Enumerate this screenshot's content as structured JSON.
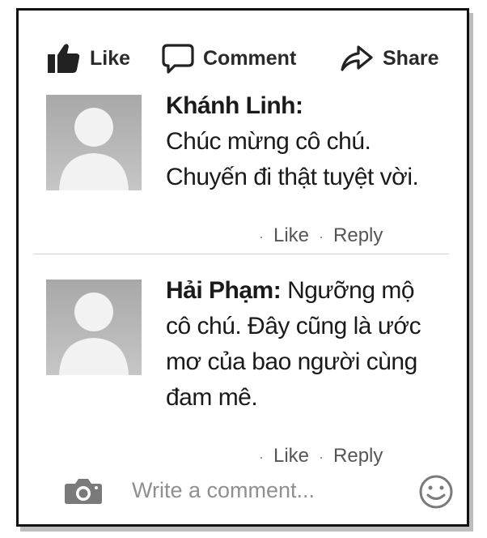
{
  "actions": {
    "like_label": "Like",
    "comment_label": "Comment",
    "share_label": "Share"
  },
  "comments": [
    {
      "author": "Khánh Linh:",
      "lines": [
        "Chúc mừng cô chú.",
        "Chuyến đi thật tuyệt vời."
      ],
      "like_label": "Like",
      "reply_label": "Reply",
      "separator": "·"
    },
    {
      "author": "Hải Phạm:",
      "first_line_rest": "Ngưỡng mộ",
      "lines": [
        "cô chú. Đây cũng là ước",
        "mơ của bao người cùng",
        "đam mê."
      ],
      "like_label": "Like",
      "reply_label": "Reply",
      "separator": "·"
    }
  ],
  "composer": {
    "placeholder": "Write a comment...",
    "camera_icon": "camera-icon",
    "emoji_icon": "smiley-icon"
  },
  "colors": {
    "border": "#111111",
    "avatar": "#b4b4b4",
    "muted_text": "#555555"
  }
}
